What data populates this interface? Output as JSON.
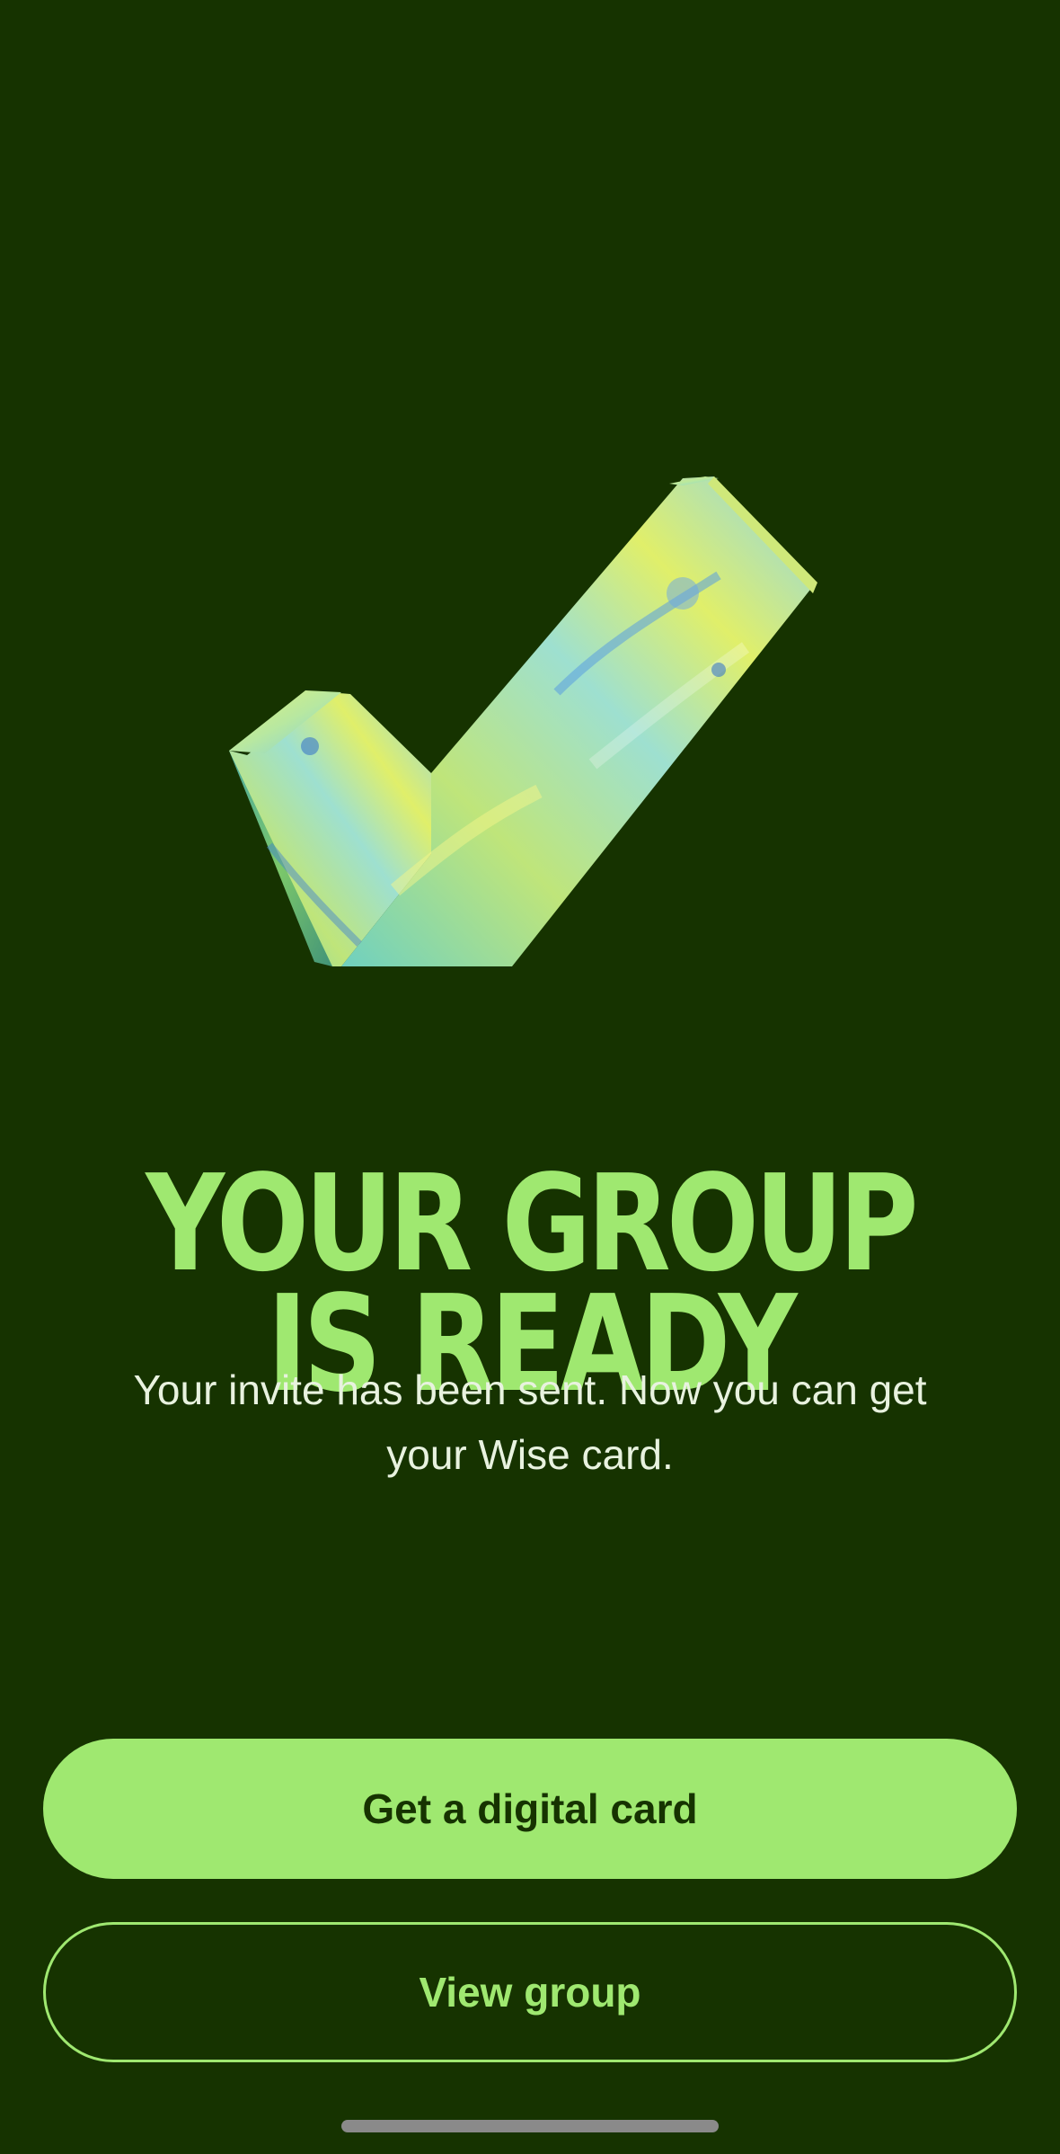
{
  "illustration": {
    "icon": "checkmark-icon",
    "colors": [
      "#7fd8b4",
      "#dcef6a",
      "#5aa8e0",
      "#a6e86a"
    ]
  },
  "headline": {
    "line1": "YOUR GROUP",
    "line2": "IS READY"
  },
  "subtitle": {
    "line1": "Your invite has been sent. Now you can get",
    "line2": "your Wise card."
  },
  "actions": {
    "primary_label": "Get a digital card",
    "secondary_label": "View group"
  },
  "theme": {
    "background": "#163300",
    "accent": "#9fe870",
    "text": "#e8f2df"
  }
}
